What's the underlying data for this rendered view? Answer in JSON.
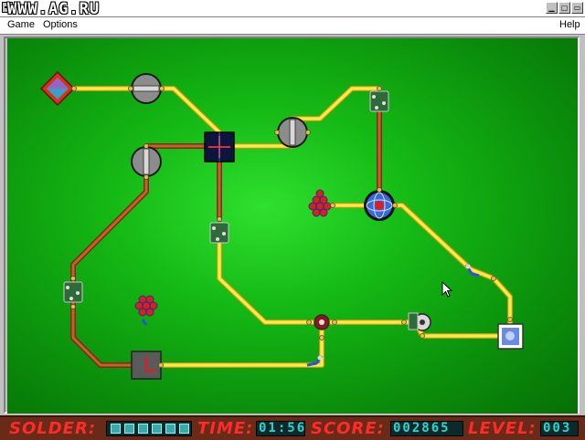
{
  "window": {
    "watermark": "WWW.AG.RU",
    "min_glyph": "▁",
    "max_glyph": "▢",
    "restore_glyph": "▭"
  },
  "menu": {
    "game": "Game",
    "options": "Options",
    "help": "Help"
  },
  "board": {
    "background_color": "#12b312",
    "wire_colors": {
      "live": "#ffe84a",
      "dead": "#b5531c"
    }
  },
  "status": {
    "solder_label": "SOLDER:",
    "solder_cells": 6,
    "time_label": "TIME:",
    "time_value": "01:56",
    "score_label": "SCORE:",
    "score_value": "002865",
    "level_label": "LEVEL:",
    "level_value": "003"
  },
  "colors": {
    "status_bg": "#6a2a18",
    "status_label": "#ff2a2a",
    "status_digits": "#27d6d6"
  }
}
